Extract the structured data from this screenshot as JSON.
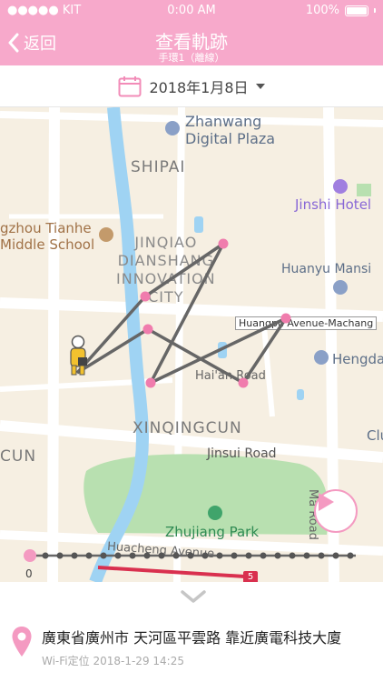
{
  "status_bar": {
    "carrier": "●●●●● KIT",
    "time": "0:00 AM",
    "battery": "100%"
  },
  "nav": {
    "back_label": "返回",
    "title": "查看軌跡",
    "subtitle": "手環1（離線）"
  },
  "date_picker": {
    "date": "2018年1月8日"
  },
  "map_labels": {
    "zhanwang": "Zhanwang\nDigital Plaza",
    "shipai": "SHIPAI",
    "jinshi": "Jinshi Hotel",
    "tianhe_school": "gzhou Tianhe\nMiddle School",
    "jinqiao": "JINQIAO\nDIANSHANG\nINNOVATION\nCITY",
    "huanyu": "Huanyu Mansi",
    "huangpu": "Huangpu Avenue-Machang",
    "hengda": "Hengda",
    "haian": "Hai'an Road",
    "xinqingcun": "XINQINGCUN",
    "cun": "CUN",
    "jinsui": "Jinsui Road",
    "clu": "Clu",
    "zhujiang": "Zhujiang Park",
    "huacheng": "Huacheng Avenue",
    "ma_road": "Ma Road",
    "badge": "5"
  },
  "timeline": {
    "start_label": "0"
  },
  "location": {
    "address": "廣東省廣州市 天河區平雲路 靠近廣電科技大廈",
    "method": "Wi-Fi定位",
    "timestamp": "2018-1-29 14:25"
  },
  "colors": {
    "header": "#f7a9cb",
    "track": "#666666",
    "point": "#f07cad"
  }
}
